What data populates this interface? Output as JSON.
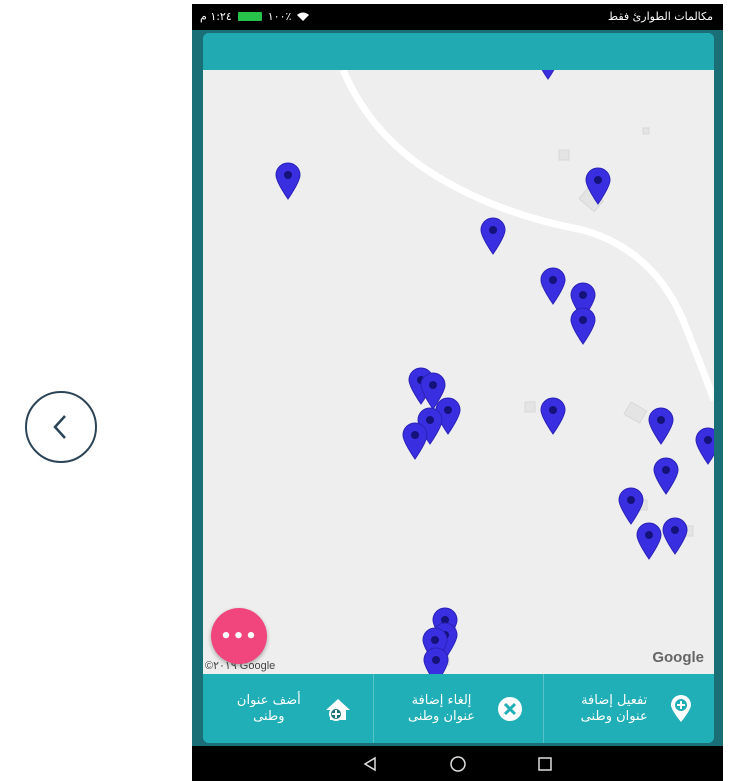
{
  "statusbar": {
    "time": "١:٢٤ م",
    "battery": "١٠٠٪",
    "carrier": "مكالمات الطوارئ فقط"
  },
  "map": {
    "attribution": "Google",
    "copyright": "©٢٠١٩ Google",
    "markers_count": 25
  },
  "fab": {
    "label": "•••"
  },
  "actions": [
    {
      "label": "أضف عنوان وطنى",
      "icon": "add-home-icon"
    },
    {
      "label": "إلغاء إضافة عنوان وطنى",
      "icon": "cancel-circle-icon"
    },
    {
      "label": "تفعيل إضافة عنوان وطنى",
      "icon": "location-add-icon"
    }
  ],
  "colors": {
    "accent": "#20aeb7",
    "fab": "#f1457d",
    "marker": "#3a2fe0"
  }
}
